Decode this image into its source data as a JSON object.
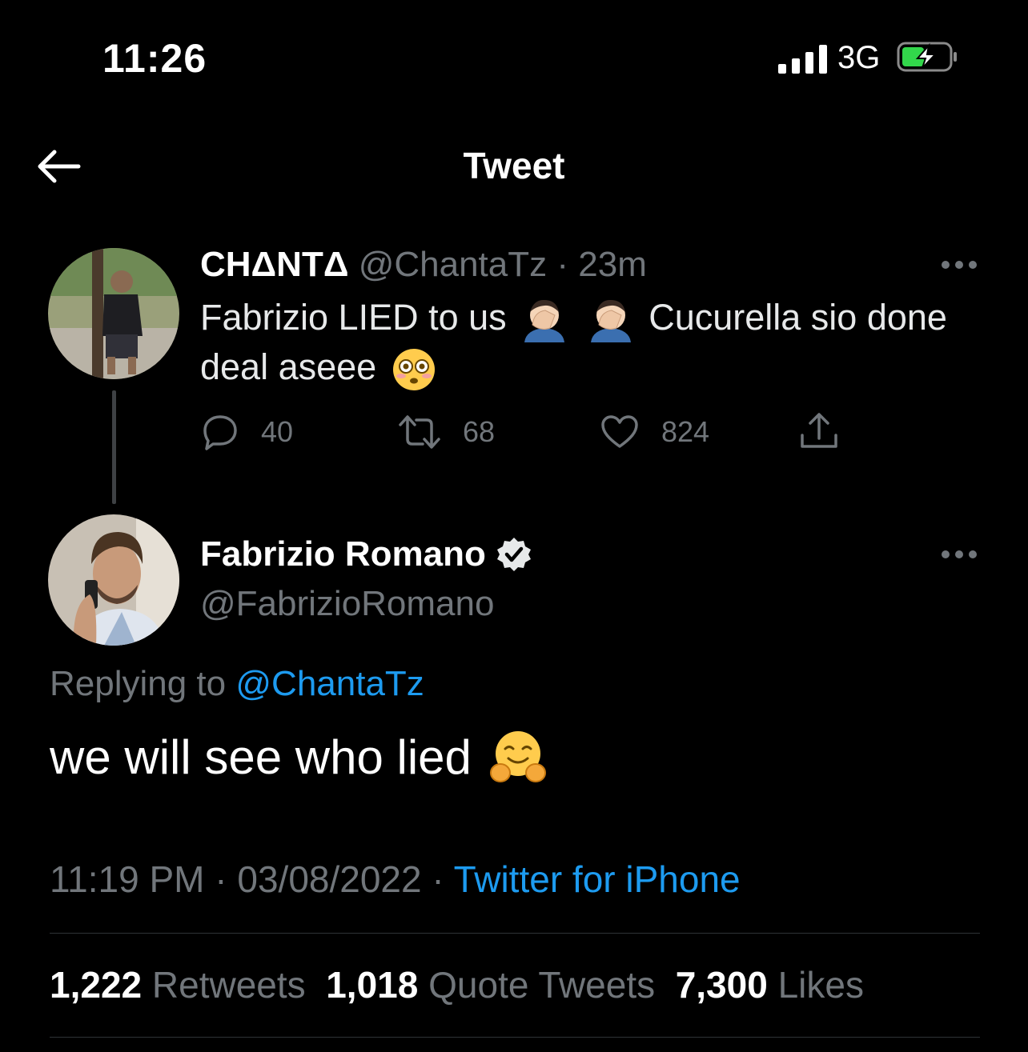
{
  "status_bar": {
    "time": "11:26",
    "network": "3G",
    "battery_state": "charging"
  },
  "nav": {
    "back_icon": "back-arrow-icon",
    "title": "Tweet"
  },
  "parent_tweet": {
    "display_name": "CHΔNTΔ",
    "handle": "@ChantaTz",
    "separator": "·",
    "age": "23m",
    "text_part1": "Fabrizio LIED to us",
    "text_part2": "Cucurella sio done deal aseee",
    "emojis": [
      "facepalm",
      "facepalm",
      "flushed-face"
    ],
    "actions": {
      "replies": "40",
      "retweets": "68",
      "likes": "824"
    }
  },
  "main_tweet": {
    "display_name": "Fabrizio Romano",
    "verified": true,
    "handle": "@FabrizioRomano",
    "replying_prefix": "Replying to",
    "replying_handle": "@ChantaTz",
    "text": "we will see who lied",
    "emoji": "hugging-face",
    "time": "11:19 PM",
    "date": "03/08/2022",
    "separator": "·",
    "source": "Twitter for iPhone",
    "stats": {
      "retweets_count": "1,222",
      "retweets_label": "Retweets",
      "quotes_count": "1,018",
      "quotes_label": "Quote Tweets",
      "likes_count": "7,300",
      "likes_label": "Likes"
    }
  },
  "colors": {
    "background": "#000000",
    "text": "#e7e9ea",
    "muted": "#71767b",
    "link": "#1d9bf0"
  }
}
